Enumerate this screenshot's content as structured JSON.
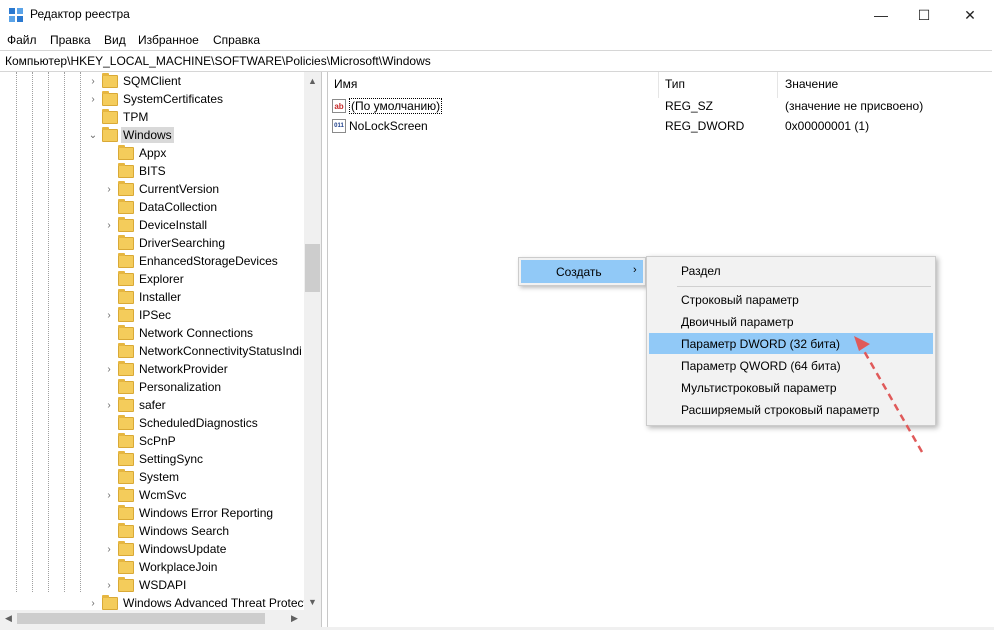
{
  "window": {
    "title": "Редактор реестра",
    "minimize": "—",
    "maximize": "☐",
    "close": "✕"
  },
  "menu": [
    "Файл",
    "Правка",
    "Вид",
    "Избранное",
    "Справка"
  ],
  "address": "Компьютер\\HKEY_LOCAL_MACHINE\\SOFTWARE\\Policies\\Microsoft\\Windows",
  "tree": {
    "top_items": [
      {
        "label": "SQMClient",
        "expander": "›"
      },
      {
        "label": "SystemCertificates",
        "expander": "›"
      },
      {
        "label": "TPM",
        "expander": ""
      },
      {
        "label": "Windows",
        "expander": "⌄",
        "selected": true
      }
    ],
    "child_items": [
      {
        "label": "Appx",
        "expander": ""
      },
      {
        "label": "BITS",
        "expander": ""
      },
      {
        "label": "CurrentVersion",
        "expander": "›"
      },
      {
        "label": "DataCollection",
        "expander": ""
      },
      {
        "label": "DeviceInstall",
        "expander": "›"
      },
      {
        "label": "DriverSearching",
        "expander": ""
      },
      {
        "label": "EnhancedStorageDevices",
        "expander": ""
      },
      {
        "label": "Explorer",
        "expander": ""
      },
      {
        "label": "Installer",
        "expander": ""
      },
      {
        "label": "IPSec",
        "expander": "›"
      },
      {
        "label": "Network Connections",
        "expander": ""
      },
      {
        "label": "NetworkConnectivityStatusIndi",
        "expander": ""
      },
      {
        "label": "NetworkProvider",
        "expander": "›"
      },
      {
        "label": "Personalization",
        "expander": ""
      },
      {
        "label": "safer",
        "expander": "›"
      },
      {
        "label": "ScheduledDiagnostics",
        "expander": ""
      },
      {
        "label": "ScPnP",
        "expander": ""
      },
      {
        "label": "SettingSync",
        "expander": ""
      },
      {
        "label": "System",
        "expander": ""
      },
      {
        "label": "WcmSvc",
        "expander": "›"
      },
      {
        "label": "Windows Error Reporting",
        "expander": ""
      },
      {
        "label": "Windows Search",
        "expander": ""
      },
      {
        "label": "WindowsUpdate",
        "expander": "›"
      },
      {
        "label": "WorkplaceJoin",
        "expander": ""
      },
      {
        "label": "WSDAPI",
        "expander": "›"
      }
    ],
    "last_item": {
      "label": "Windows Advanced Threat Protect",
      "expander": "›"
    }
  },
  "list": {
    "columns": {
      "name": "Имя",
      "type": "Тип",
      "value": "Значение"
    },
    "rows": [
      {
        "icon": "string-value-icon",
        "icon_text": "ab",
        "name": "(По умолчанию)",
        "type": "REG_SZ",
        "value": "(значение не присвоено)"
      },
      {
        "icon": "binary-value-icon",
        "icon_text": "011",
        "name": "NoLockScreen",
        "type": "REG_DWORD",
        "value": "0x00000001 (1)"
      }
    ]
  },
  "context_menu": {
    "create": "Создать",
    "create_arrow": "›"
  },
  "submenu": {
    "items": [
      "Раздел",
      "Строковый параметр",
      "Двоичный параметр",
      "Параметр DWORD (32 бита)",
      "Параметр QWORD (64 бита)",
      "Мультистроковый параметр",
      "Расширяемый строковый параметр"
    ],
    "highlighted_index": 3
  },
  "scroll_arrows": {
    "up": "▲",
    "down": "▼",
    "left": "◀",
    "right": "▶"
  },
  "colors": {
    "highlight": "#91c9f7",
    "folder": "#f4cc5b",
    "annotation_arrow": "#e05a5a"
  }
}
